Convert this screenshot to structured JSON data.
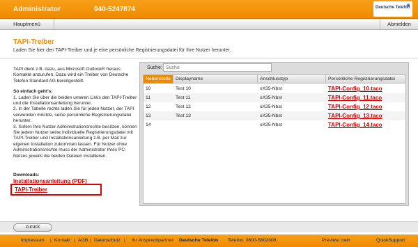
{
  "header": {
    "title": "Administrator",
    "phone": "040-5247874",
    "logo_text": "Deutsche Telefon"
  },
  "nav": {
    "main": "Hauptmenü",
    "logout": "Abmelden"
  },
  "page": {
    "title": "TAPI-Treiber",
    "intro": "Laden Sie hier den TAPI-Treiber und je eine persönliche Registrierungsdatei für Ihre Nutzer herunter."
  },
  "info": {
    "p1": "TAPI dient z.B. dazu, aus Microsoft Outlook® heraus Kontakte anzurufen. Dazu wird ein Treiber von Deutsche Telefon Standard AG bereitgestellt.",
    "how_head": "So einfach geht's:",
    "steps": [
      "1. Laden Sie über die beiden unteren Links den TAPI-Treiber und die Installationsanleitung herunter.",
      "2. In der Tabelle rechts laden Sie für jeden Nutzer, der TAPI verwenden möchte, seine persönliche Registrierungsdatei herunter.",
      "3. Sofern Ihre Nutzer Administrationsrechte besitzen, können Sie jedem Nutzer seine individuelle Registrierungsdatei mit TAPI-Treiber und Installationsanleitung z.B. per Mail zur eigenen Installation zukommen lassen. Für Nutzer ohne Administrationsrechte muss der Administrator Ihres PC-Netzes jeweils die beiden Dateien installieren."
    ]
  },
  "downloads": {
    "head": "Downloads:",
    "manual": "Installationsanleitung (PDF)",
    "driver": "TAPI-Treiber"
  },
  "search": {
    "label": "Suche:",
    "placeholder": "Suche"
  },
  "table": {
    "headers": [
      "Nebenstelle",
      "Displayname",
      "Anschlusstyp",
      "Persönliche Registrierungsdatei"
    ],
    "rows": [
      {
        "ext": "10",
        "name": "Test 10",
        "type": "xX35-Nbst",
        "file": "TAPI-Config_10.taco"
      },
      {
        "ext": "11",
        "name": "Test 11",
        "type": "xX35-Nbst",
        "file": "TAPI-Config_11.taco"
      },
      {
        "ext": "12",
        "name": "Test 12",
        "type": "xX35-Nbst",
        "file": "TAPI-Config_12.taco"
      },
      {
        "ext": "13",
        "name": "Test 13",
        "type": "xX35-Nbst",
        "file": "TAPI-Config_13.taco"
      },
      {
        "ext": "14",
        "name": "",
        "type": "xX35-Nbst",
        "file": "TAPI-Config_14.taco"
      }
    ]
  },
  "back": "zurück",
  "footer": {
    "impressum": "Impressum",
    "kontakt": "Kontakt",
    "agb": "AGB",
    "datenschutz": "Datenschutz",
    "contact_label": "Ihr Ansprechpartner:",
    "contact_name": "Deutsche Telefon",
    "tel": "Telefon: 0800-5802008",
    "preview": "Preview: nein",
    "support": "QuickSupport"
  },
  "colors": {
    "brand_orange": "#f08a00",
    "link_red": "#d40000",
    "highlight_red": "#e00000"
  }
}
